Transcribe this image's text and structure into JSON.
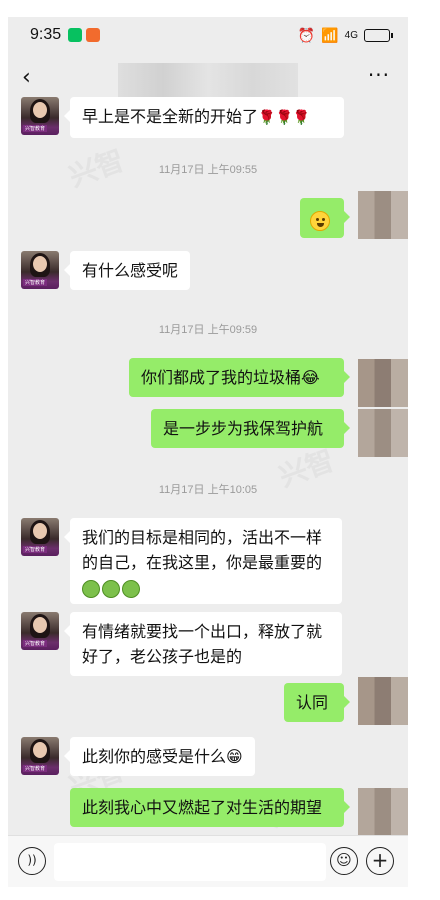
{
  "status_bar": {
    "time": "9:35",
    "signal": "4G"
  },
  "nav": {
    "back_icon": "chevron-left-icon",
    "more_label": "···"
  },
  "watermark": "兴智",
  "messages": [
    {
      "side": "left",
      "text": "早上是不是全新的开始了",
      "suffix": "🌹🌹🌹"
    },
    {
      "timestamp": "11月17日 上午09:55"
    },
    {
      "side": "right",
      "emoji": "smile-face"
    },
    {
      "side": "left",
      "text": "有什么感受呢"
    },
    {
      "timestamp": "11月17日 上午09:59"
    },
    {
      "side": "right",
      "text": "你们都成了我的垃圾桶😂"
    },
    {
      "side": "right",
      "text": "是一步步为我保驾护航"
    },
    {
      "timestamp": "11月17日 上午10:05"
    },
    {
      "side": "left",
      "text": "我们的目标是相同的，活出不一样的自己，在我这里，你是最重要的"
    },
    {
      "side": "left",
      "text": "有情绪就要找一个出口，释放了就好了，老公孩子也是的"
    },
    {
      "side": "right",
      "text": "认同"
    },
    {
      "side": "left",
      "text": "此刻你的感受是什么😁"
    },
    {
      "side": "right",
      "text": "此刻我心中又燃起了对生活的期望"
    }
  ],
  "avatar_tag": "兴智教育",
  "input_bar": {
    "voice_icon": "voice-icon",
    "emoji_icon": "emoji-icon",
    "plus_icon": "plus-icon"
  },
  "colors": {
    "bubble_right": "#95ec69",
    "bubble_left": "#ffffff",
    "background": "#ededed"
  }
}
